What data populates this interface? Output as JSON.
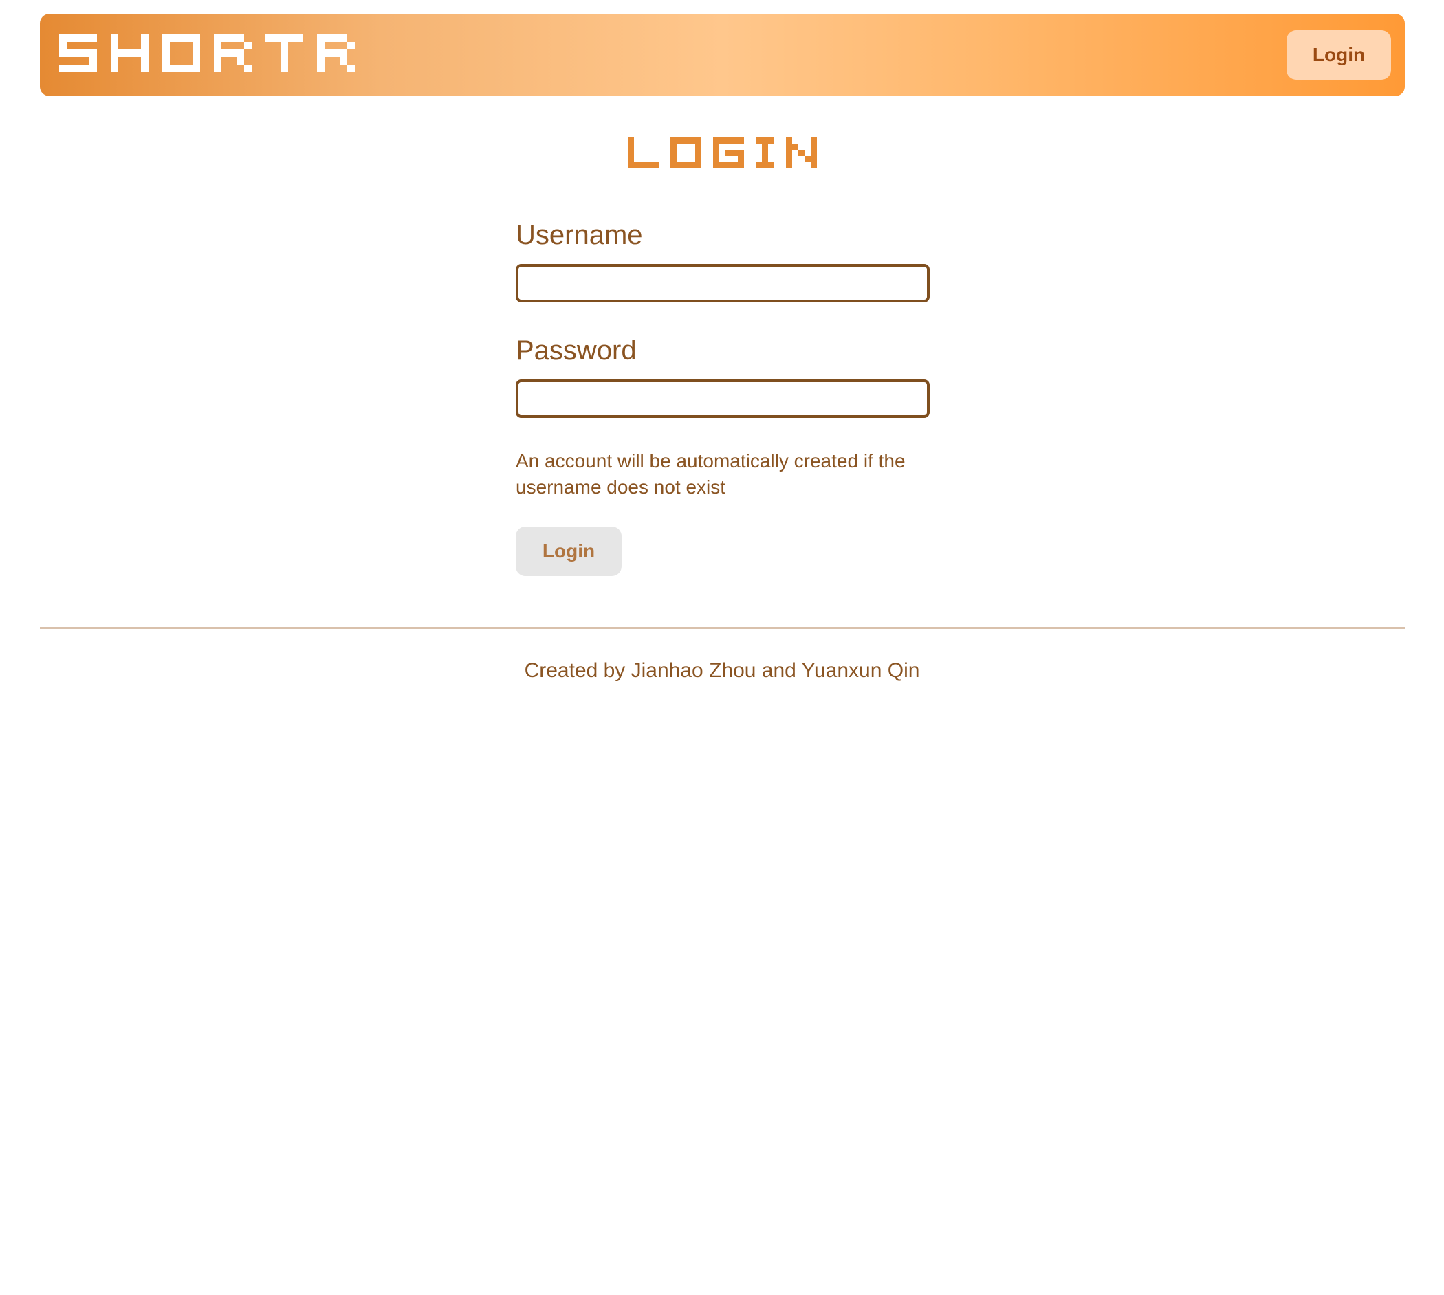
{
  "header": {
    "logo_text": "SHORTR",
    "login_label": "Login"
  },
  "page": {
    "title": "LOGIN"
  },
  "form": {
    "username_label": "Username",
    "username_value": "",
    "password_label": "Password",
    "password_value": "",
    "note": "An account will be automatically created if the username does not exist",
    "submit_label": "Login"
  },
  "footer": {
    "credit": "Created by Jianhao Zhou and Yuanxun Qin"
  },
  "colors": {
    "brand_orange": "#e58a33",
    "text_brown": "#8a5422",
    "header_button_bg": "#ffd6b2",
    "submit_bg": "#e6e6e6"
  },
  "icons": {
    "logo": "pixel-wordmark"
  }
}
